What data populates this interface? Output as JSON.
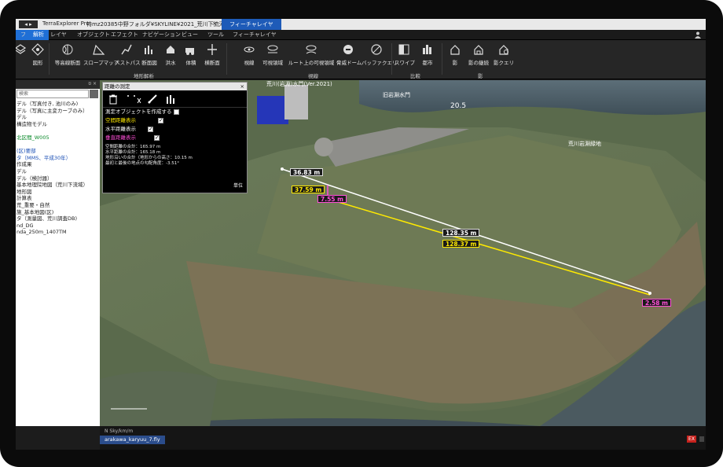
{
  "titlebar": {
    "app_name": "TerraExplorer Pro",
    "path": "特mz20385中野フォルダ¥SKYLINE¥2021_荒川下流河道¥04_FLY¥…",
    "close": "×",
    "context_tab": "フィーチャレイヤ"
  },
  "tabs": [
    {
      "label": "ファイル"
    },
    {
      "label": "解析"
    },
    {
      "label": "レイヤ"
    },
    {
      "label": "オブジェクト"
    },
    {
      "label": "エフェクト"
    },
    {
      "label": "ナビゲーション"
    },
    {
      "label": "ビュー"
    },
    {
      "label": "ツール"
    },
    {
      "label": "フィーチャレイヤ"
    }
  ],
  "ribbon": {
    "buttons": [
      {
        "label": "",
        "icon": "layers-icon"
      },
      {
        "label": "図形",
        "icon": "polygon-icon"
      },
      {
        "label": "等高線断面",
        "icon": "contour-icon"
      },
      {
        "label": "スロープマップ",
        "icon": "slope-icon"
      },
      {
        "label": "ベストパス",
        "icon": "best-path-icon"
      },
      {
        "label": "断面図",
        "icon": "profile-icon"
      },
      {
        "label": "洪水",
        "icon": "flood-icon"
      },
      {
        "label": "体積",
        "icon": "volume-icon"
      },
      {
        "label": "横断面",
        "icon": "cross-section-icon"
      },
      {
        "label": "視線",
        "icon": "line-of-sight-icon"
      },
      {
        "label": "可視領域",
        "icon": "viewshed-icon"
      },
      {
        "label": "ルート上の可視領域",
        "icon": "route-viewshed-icon"
      },
      {
        "label": "脅威ドーム",
        "icon": "threat-dome-icon"
      },
      {
        "label": "バッファクエリ",
        "icon": "buffer-query-icon"
      },
      {
        "label": "スワイプ",
        "icon": "swipe-icon"
      },
      {
        "label": "都市",
        "icon": "city-icon"
      },
      {
        "label": "影",
        "icon": "shadow-icon"
      },
      {
        "label": "影の継続",
        "icon": "shadow-duration-icon"
      },
      {
        "label": "影クエリ",
        "icon": "shadow-query-icon"
      }
    ],
    "groups": [
      "地形解析",
      "視線",
      "比較",
      "影"
    ]
  },
  "left_panel": {
    "header_controls": "ʊ ×",
    "search_placeholder": "検索",
    "items": [
      {
        "label": "デル（写真付き, 池川のみ)",
        "color": "default"
      },
      {
        "label": "デル（写真に主変カーブのみ）",
        "color": "default"
      },
      {
        "label": "デル",
        "color": "default"
      },
      {
        "label": "構造物モデル",
        "color": "default"
      },
      {
        "label": "",
        "color": "default"
      },
      {
        "label": "北区間_W005",
        "color": "green"
      },
      {
        "label": "",
        "color": "default"
      },
      {
        "label": "(区)要部",
        "color": "blue"
      },
      {
        "label": "タ（MMS、平成30年）",
        "color": "blue"
      },
      {
        "label": "作成果",
        "color": "default"
      },
      {
        "label": "デル",
        "color": "default"
      },
      {
        "label": "デル（検討器）",
        "color": "default"
      },
      {
        "label": "基本地理院地図（荒川下流域）",
        "color": "default"
      },
      {
        "label": "地形図",
        "color": "default"
      },
      {
        "label": "計算表",
        "color": "default"
      },
      {
        "label": "荒_重要・自然",
        "color": "default"
      },
      {
        "label": "施_基本地図(区)",
        "color": "default"
      },
      {
        "label": "タ（測量図、荒川調査DB)",
        "color": "default"
      },
      {
        "label": "nd_DG",
        "color": "default"
      },
      {
        "label": "nda_250m_1407TM",
        "color": "default"
      }
    ]
  },
  "dialog": {
    "title": "距離の測定",
    "close": "×",
    "tools": [
      "trash-icon",
      "path-icon",
      "measure-icon",
      "chart-icon"
    ],
    "option_label": "測定オブジェクトを作成する",
    "rows": [
      {
        "label": "空間距離表示",
        "color": "#ffea00",
        "checked": true
      },
      {
        "label": "水平距離表示",
        "color": "#ffffff",
        "checked": true
      },
      {
        "label": "垂直距離表示",
        "color": "#ff4fd8",
        "checked": true
      }
    ],
    "results": [
      "空間距離の合計：165.97 m",
      "水平距離の合計：165.18 m",
      "地形沿いの合計（地形からの高さ：10.15 m",
      "最初と最後の地点の勾配角度：-3.51°"
    ],
    "unit_label": "単位"
  },
  "map": {
    "measurements": {
      "h1": "36.83 m",
      "s1": "37.59 m",
      "v1": "7.55 m",
      "h2": "128.35 m",
      "s2": "128.37 m",
      "v2": "2.58 m"
    },
    "place_labels": {
      "gate": "旧岩淵水門",
      "building": "荒川(岩淵)水門(Ver.2021)",
      "elevation": "20.5",
      "area": "荒川岩淵緑地"
    }
  },
  "status": {
    "coords": "N Sky/km/m",
    "project": "arakawa_karyuu_7.fly",
    "error_badge": "EX"
  }
}
